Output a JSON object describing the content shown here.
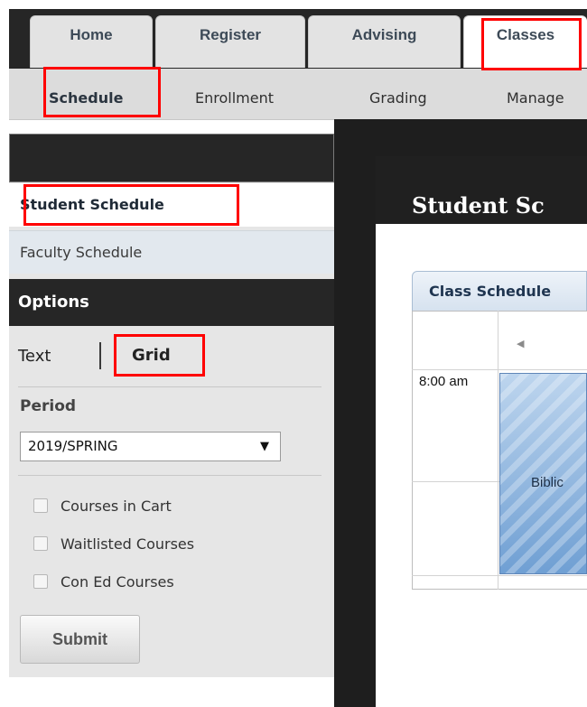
{
  "tabs": [
    {
      "label": "Home",
      "active": false
    },
    {
      "label": "Register",
      "active": false
    },
    {
      "label": "Advising",
      "active": false
    },
    {
      "label": "Classes",
      "active": true
    }
  ],
  "subnav": [
    {
      "label": "Schedule",
      "active": true
    },
    {
      "label": "Enrollment",
      "active": false
    },
    {
      "label": "Grading",
      "active": false
    },
    {
      "label": "Manage",
      "active": false
    }
  ],
  "sidebar": {
    "links": [
      {
        "label": "Student Schedule",
        "active": true
      },
      {
        "label": "Faculty Schedule",
        "active": false
      }
    ],
    "options_title": "Options",
    "view_text": "Text",
    "view_grid": "Grid",
    "period_label": "Period",
    "period_value": "2019/SPRING",
    "checkboxes": [
      {
        "label": "Courses in Cart",
        "checked": false
      },
      {
        "label": "Waitlisted Courses",
        "checked": false
      },
      {
        "label": "Con Ed Courses",
        "checked": false
      }
    ],
    "submit_label": "Submit"
  },
  "main": {
    "title": "Student Sc",
    "calendar_tab": "Class Schedule",
    "time_label": "8:00 am",
    "event_text": "Biblic"
  },
  "colors": {
    "highlight": "#ff0000",
    "event": "#6f9fd3"
  }
}
